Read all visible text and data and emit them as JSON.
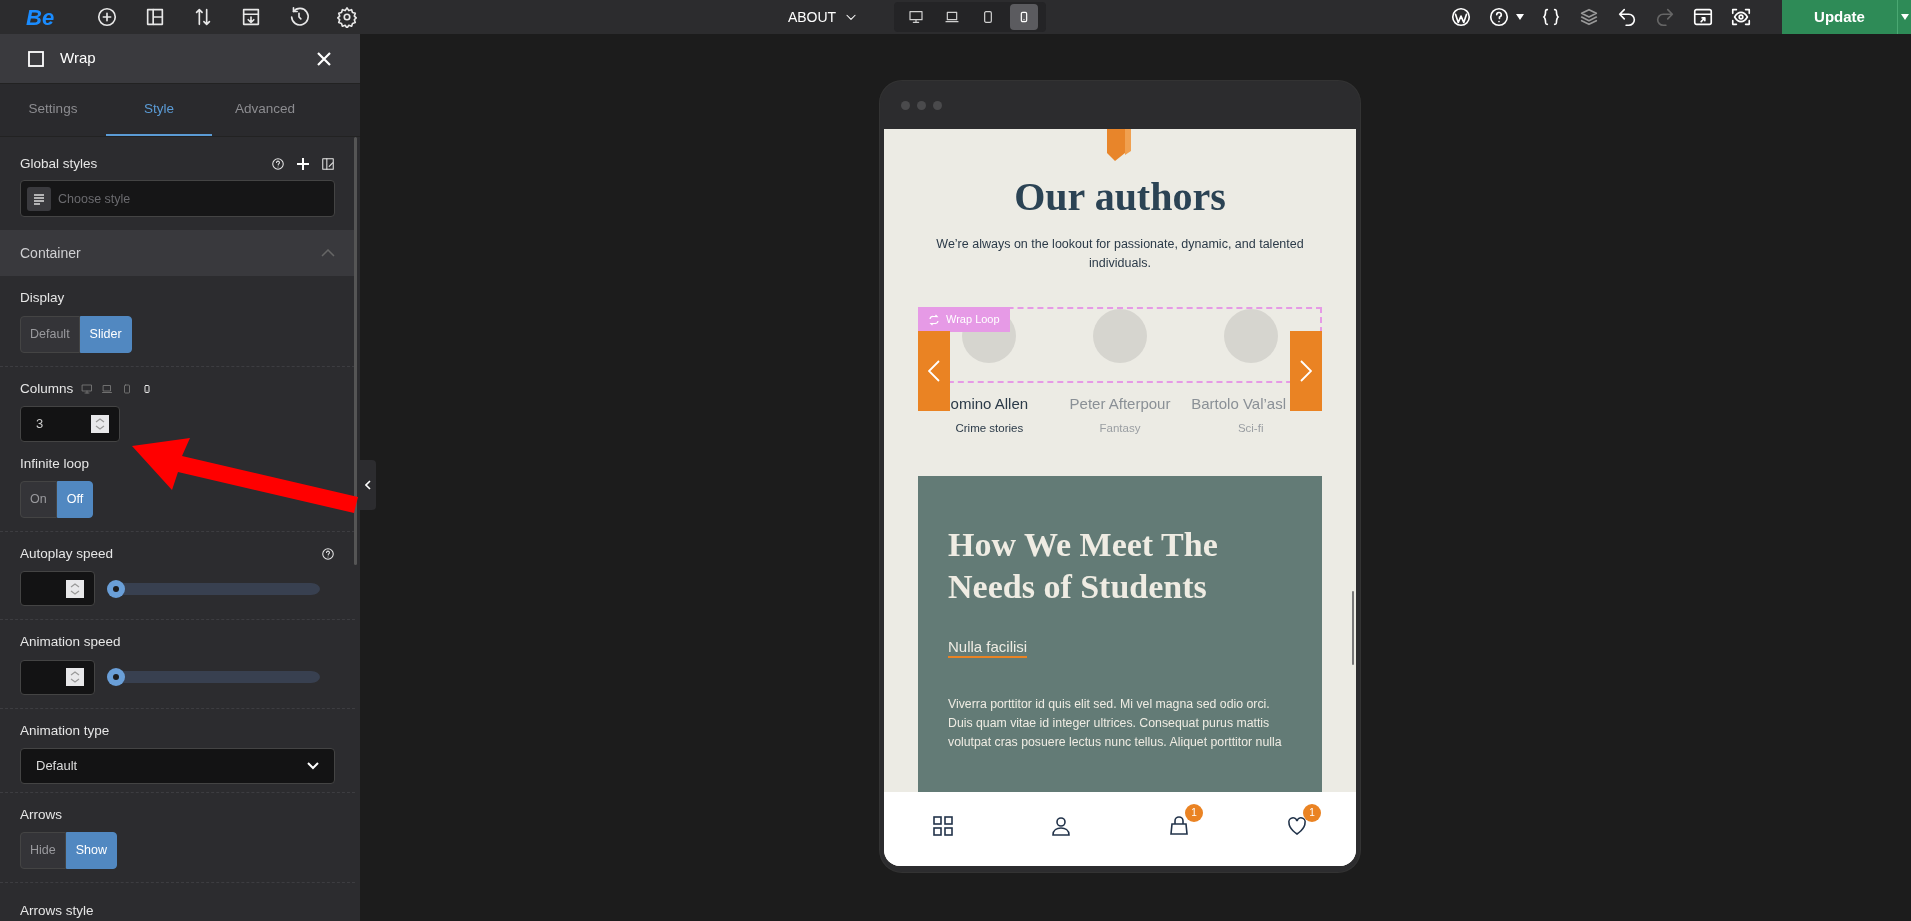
{
  "topbar": {
    "logo": "Be",
    "page_selector": "ABOUT",
    "devices": [
      {
        "selected": false
      },
      {
        "selected": false
      },
      {
        "selected": false
      },
      {
        "selected": true
      }
    ],
    "update_button": "Update"
  },
  "panel": {
    "title": "Wrap",
    "tabs": [
      {
        "label": "Settings",
        "selected": false
      },
      {
        "label": "Style",
        "selected": true
      },
      {
        "label": "Advanced",
        "selected": false
      }
    ],
    "global_styles": {
      "label": "Global styles",
      "placeholder": "Choose style"
    },
    "section": {
      "title": "Container",
      "expanded": true
    },
    "controls": [
      {
        "kind": "toggle",
        "label": "Display",
        "options": [
          {
            "label": "Default",
            "selected": false
          },
          {
            "label": "Slider",
            "selected": true
          }
        ]
      },
      {
        "kind": "number",
        "label": "Columns",
        "value": "3"
      },
      {
        "kind": "toggle",
        "label": "Infinite loop",
        "options": [
          {
            "label": "On",
            "selected": false
          },
          {
            "label": "Off",
            "selected": true
          }
        ]
      },
      {
        "kind": "slider",
        "label": "Autoplay speed",
        "help": true,
        "level": 0
      },
      {
        "kind": "slider",
        "label": "Animation speed",
        "help": false,
        "level": 0
      },
      {
        "kind": "select",
        "label": "Animation type",
        "value": "Default"
      },
      {
        "kind": "toggle",
        "label": "Arrows",
        "options": [
          {
            "label": "Hide",
            "selected": false
          },
          {
            "label": "Show",
            "selected": true
          }
        ]
      },
      {
        "kind": "heading",
        "label": "Arrows style"
      }
    ]
  },
  "canvas": {
    "heading": "Our authors",
    "intro": "We’re always on the lookout for passionate, dynamic, and talented individuals.",
    "wrap_label": "Wrap Loop",
    "authors": [
      {
        "name": "omino Allen",
        "genre": "Crime stories",
        "active": true
      },
      {
        "name": "Peter Afterpour",
        "genre": "Fantasy",
        "active": false
      },
      {
        "name": "Bartolo Val’asl",
        "genre": "Sci-fi",
        "active": false
      }
    ],
    "feature": {
      "title": "How We Meet The Needs of Students",
      "link": "Nulla facilisi",
      "body": "Viverra porttitor id quis elit sed. Mi vel magna sed odio orci. Duis quam vitae id integer ultrices. Consequat purus mattis volutpat cras posuere lectus nunc tellus. Aliquet porttitor nulla"
    },
    "bottom_nav": [
      {
        "kind": "grid"
      },
      {
        "kind": "user"
      },
      {
        "kind": "bag",
        "badge": "1"
      },
      {
        "kind": "heart",
        "badge": "1"
      }
    ]
  }
}
